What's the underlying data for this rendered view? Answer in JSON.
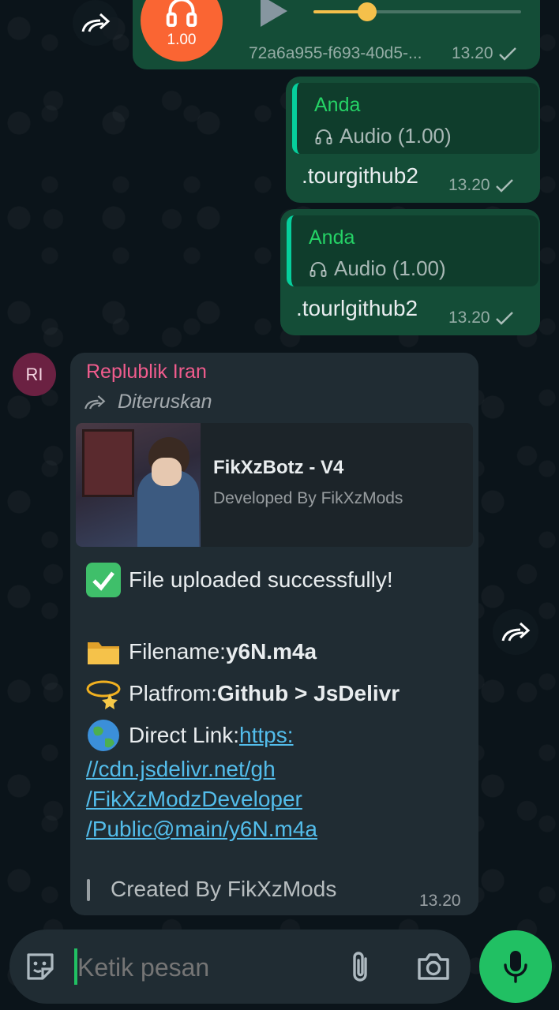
{
  "audio_message": {
    "speed": "1.00",
    "filename": "72a6a955-f693-40d5-...",
    "time": "13.20",
    "progress": 0.26
  },
  "reply_messages": [
    {
      "quote_name": "Anda",
      "quote_text": "Audio (1.00)",
      "text": ".tourgithub2",
      "time": "13.20"
    },
    {
      "quote_name": "Anda",
      "quote_text": "Audio (1.00)",
      "text": ".tourlgithub2",
      "time": "13.20"
    }
  ],
  "incoming": {
    "avatar_initials": "RI",
    "sender": "Replublik Iran",
    "forwarded_label": "Diteruskan",
    "preview": {
      "title": "FikXzBotz - V4",
      "subtitle": "Developed By FikXzMods"
    },
    "success_text": "File uploaded successfully!",
    "filename_label": "Filename: ",
    "filename_value": "y6N.m4a",
    "platform_label": "Platfrom: ",
    "platform_value": "Github > JsDelivr",
    "direct_link_label": "Direct Link: ",
    "link_lines": [
      "https:",
      "//cdn.jsdelivr.net/gh",
      "/FikXzModzDeveloper",
      "/Public@main/y6N.m4a"
    ],
    "created_by": "Created By FikXzMods",
    "time": "13.20"
  },
  "composer": {
    "placeholder": "Ketik pesan"
  },
  "colors": {
    "outgoing_bubble": "#144d37",
    "incoming_bubble": "#202c33",
    "accent_green": "#21c063",
    "sender_name": "#f15c8d",
    "link": "#53bdeb",
    "audio_avatar": "#fa6533"
  },
  "icons": [
    "forward-icon",
    "headphones-icon",
    "play-icon",
    "double-check-icon",
    "sticker-icon",
    "attach-icon",
    "camera-icon",
    "mic-icon"
  ]
}
